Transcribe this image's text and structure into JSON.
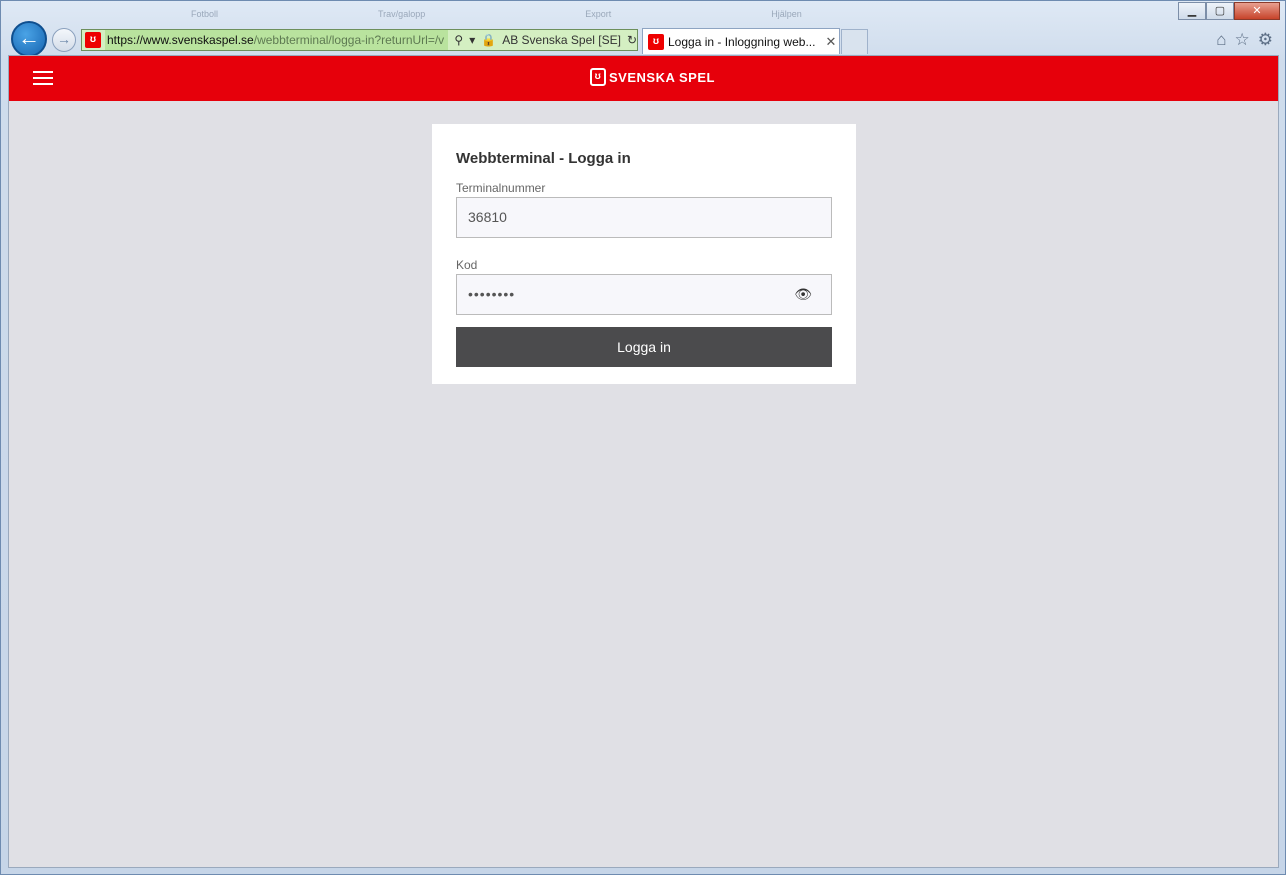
{
  "browser": {
    "ghost_titles": [
      "Fotboll",
      "Trav/galopp",
      "Export",
      "Hjälpen"
    ],
    "address": {
      "host": "https://www.svenskaspel.se",
      "path": "/webbterminal/logga-in?returnUrl=/v",
      "certificate": "AB Svenska Spel [SE]"
    },
    "tab": {
      "title": "Logga in - Inloggning web...",
      "close": "✕"
    },
    "window_buttons": {
      "minimize": "▁",
      "maximize": "▢",
      "close": "✕"
    },
    "tools": {
      "home": "⌂",
      "favorites": "☆",
      "settings": "⚙"
    }
  },
  "site": {
    "brand": "SVENSKA SPEL",
    "brand_color": "#e6000b"
  },
  "login": {
    "title": "Webbterminal - Logga in",
    "terminal_label": "Terminalnummer",
    "terminal_value": "36810",
    "code_label": "Kod",
    "code_value": "••••••••",
    "submit_label": "Logga in"
  }
}
